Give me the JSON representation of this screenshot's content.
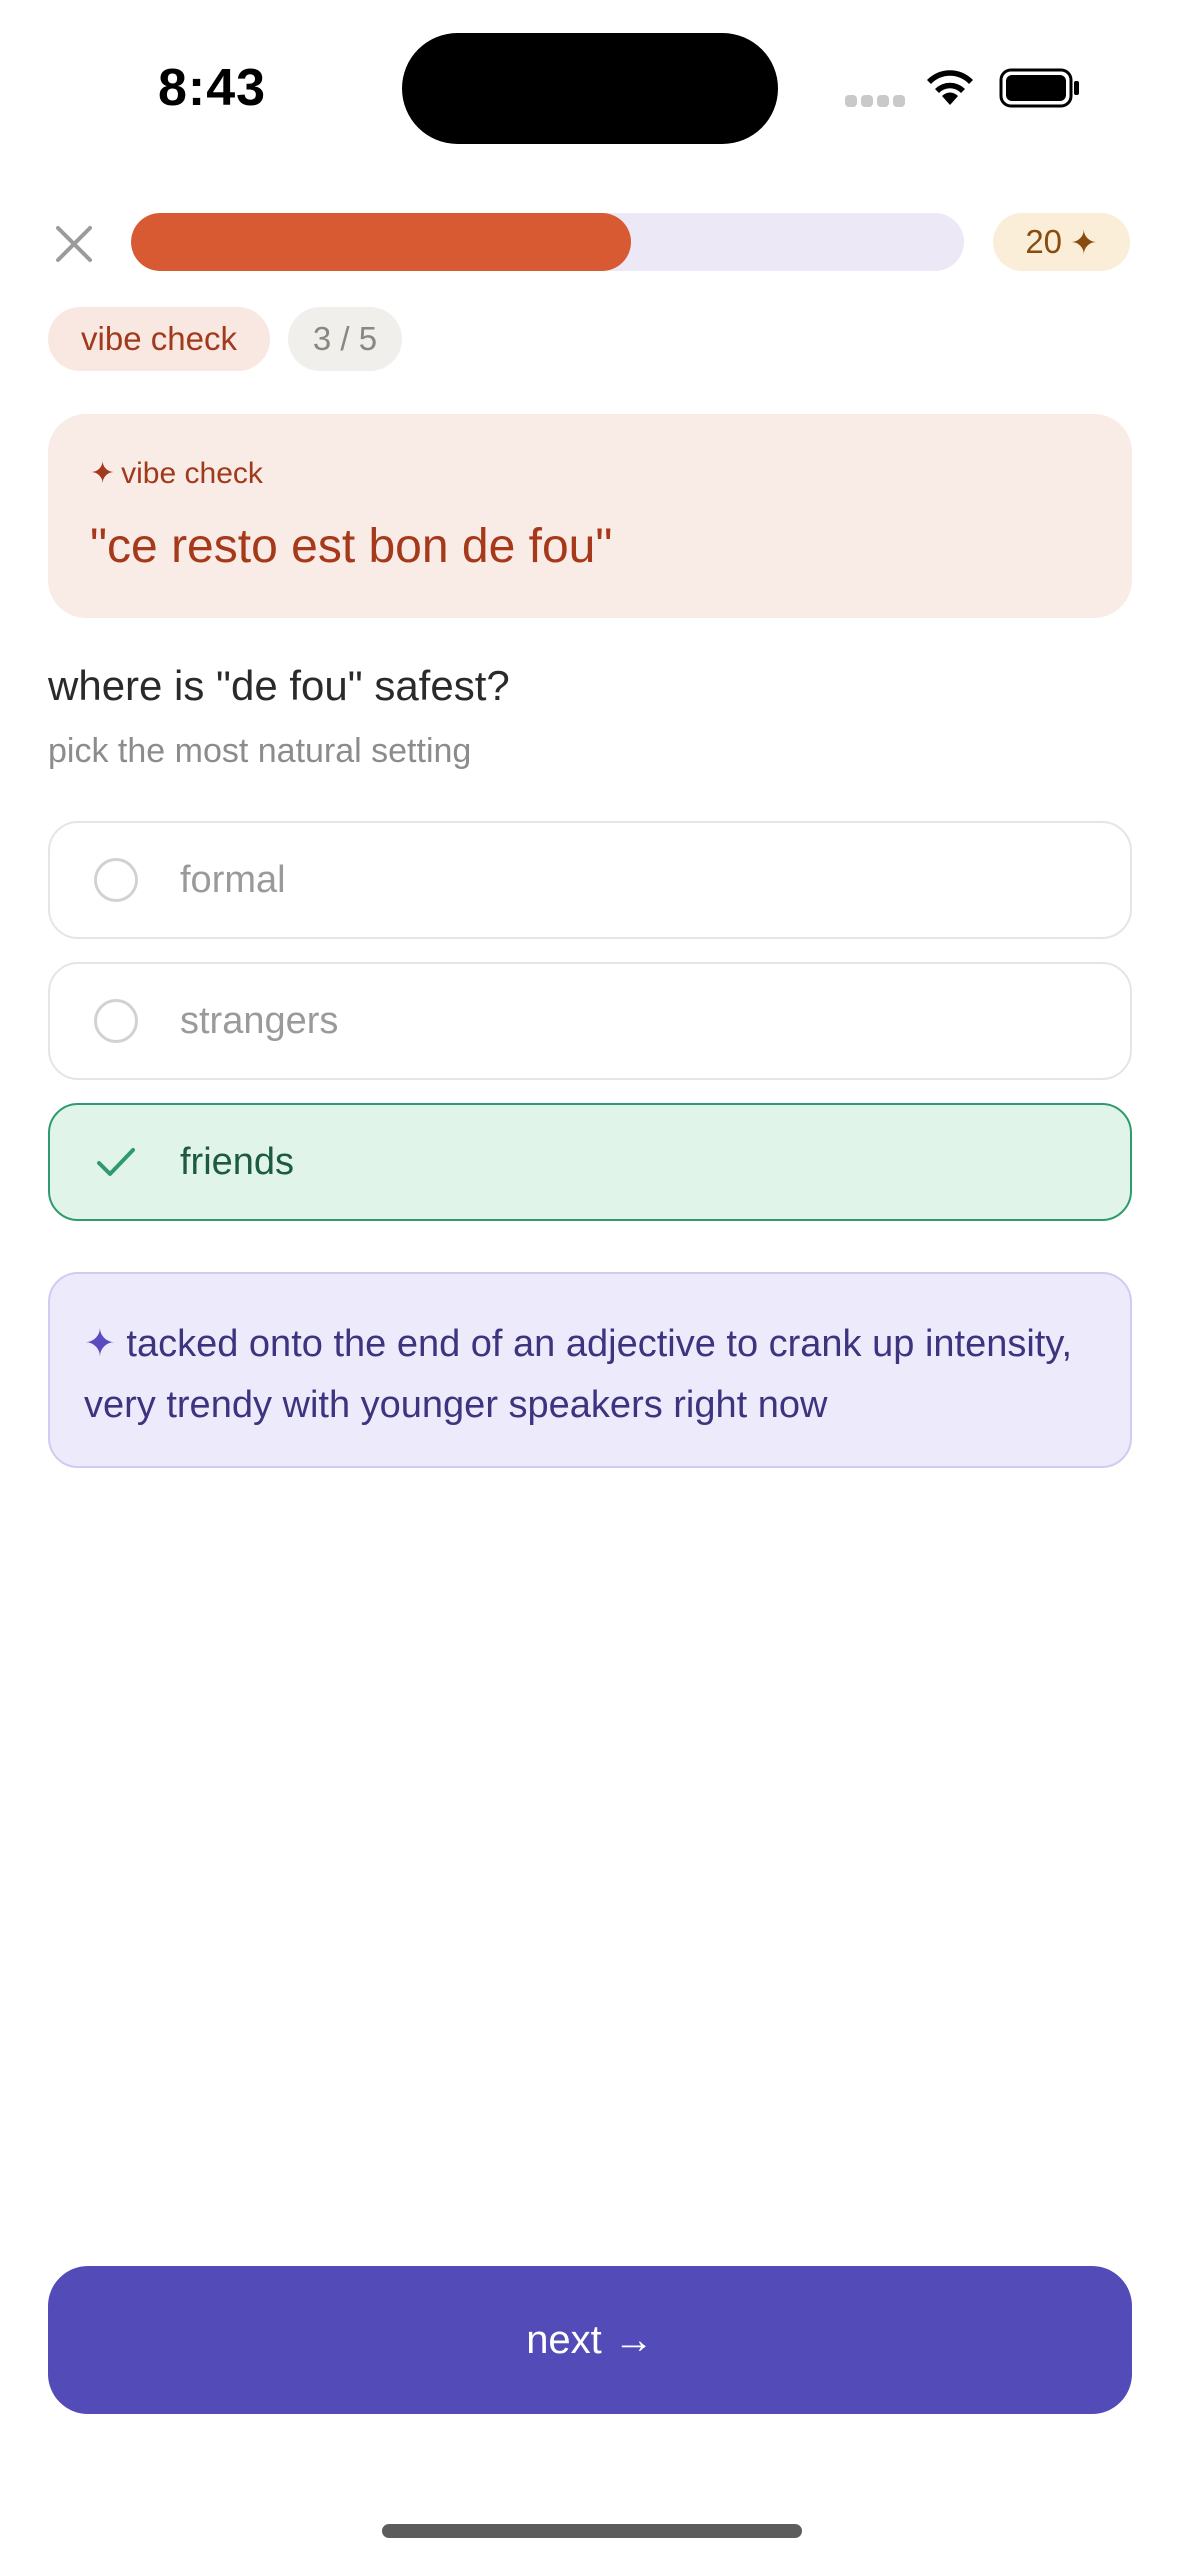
{
  "status_bar": {
    "time": "8:43"
  },
  "top_bar": {
    "close_icon": "close-icon",
    "progress_fraction": 0.6,
    "points_value": "20",
    "points_icon": "sparkle-icon"
  },
  "tags": {
    "type": "vibe check",
    "count": "3 / 5"
  },
  "prompt": {
    "label_icon": "✦",
    "label": "vibe check",
    "quote": "\"ce resto est bon de fou\""
  },
  "question": {
    "title": "where is \"de fou\" safest?",
    "subtitle": "pick the most natural setting"
  },
  "options": [
    {
      "label": "formal",
      "selected": false
    },
    {
      "label": "strangers",
      "selected": false
    },
    {
      "label": "friends",
      "selected": true
    }
  ],
  "hint": {
    "icon": "✦",
    "text": "tacked onto the end of an adjective to crank up intensity, very trendy with younger speakers right now"
  },
  "next_button": {
    "label": "next",
    "icon": "→"
  },
  "colors": {
    "accent": "#524bb8",
    "progress": "#d85a33",
    "selected_bg": "#e1f4ea",
    "selected_border": "#2f9a6c"
  }
}
